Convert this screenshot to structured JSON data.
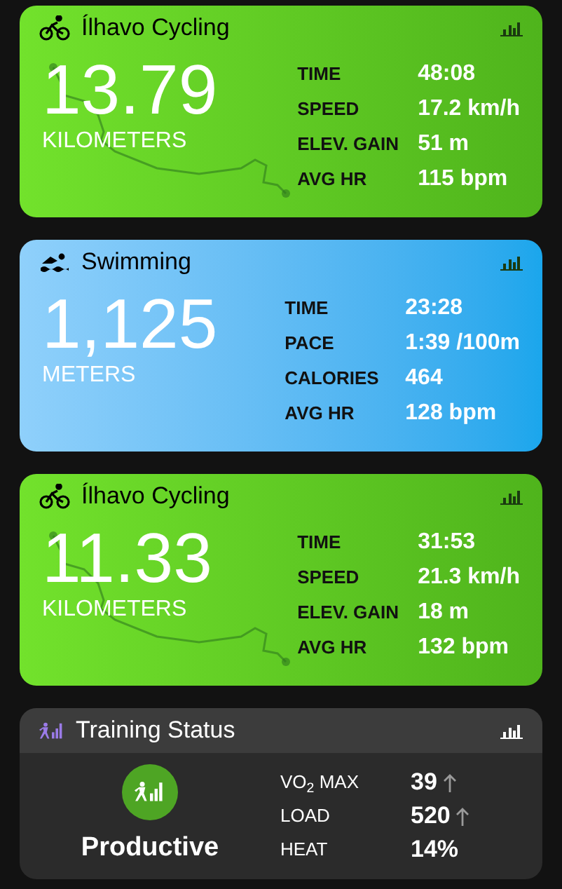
{
  "activities": [
    {
      "kind": "cycling",
      "title": "Ílhavo Cycling",
      "big_value": "13.79",
      "unit": "KILOMETERS",
      "stats": [
        {
          "label": "TIME",
          "value": "48:08"
        },
        {
          "label": "SPEED",
          "value": "17.2 km/h"
        },
        {
          "label": "ELEV. GAIN",
          "value": "51 m"
        },
        {
          "label": "AVG HR",
          "value": "115 bpm"
        }
      ]
    },
    {
      "kind": "swimming",
      "title": "Swimming",
      "big_value": "1,125",
      "unit": "METERS",
      "stats": [
        {
          "label": "TIME",
          "value": "23:28"
        },
        {
          "label": "PACE",
          "value": "1:39 /100m"
        },
        {
          "label": "CALORIES",
          "value": "464"
        },
        {
          "label": "AVG HR",
          "value": "128 bpm"
        }
      ]
    },
    {
      "kind": "cycling",
      "title": "Ílhavo Cycling",
      "big_value": "11.33",
      "unit": "KILOMETERS",
      "stats": [
        {
          "label": "TIME",
          "value": "31:53"
        },
        {
          "label": "SPEED",
          "value": "21.3 km/h"
        },
        {
          "label": "ELEV. GAIN",
          "value": "18 m"
        },
        {
          "label": "AVG HR",
          "value": "132 bpm"
        }
      ]
    }
  ],
  "training_status": {
    "title": "Training Status",
    "status": "Productive",
    "metrics": [
      {
        "label": "VO$_{2}$ MAX",
        "value": "39",
        "rising": true
      },
      {
        "label": "LOAD",
        "value": "520",
        "rising": true
      },
      {
        "label": "HEAT",
        "value": "14%",
        "rising": false
      }
    ]
  }
}
